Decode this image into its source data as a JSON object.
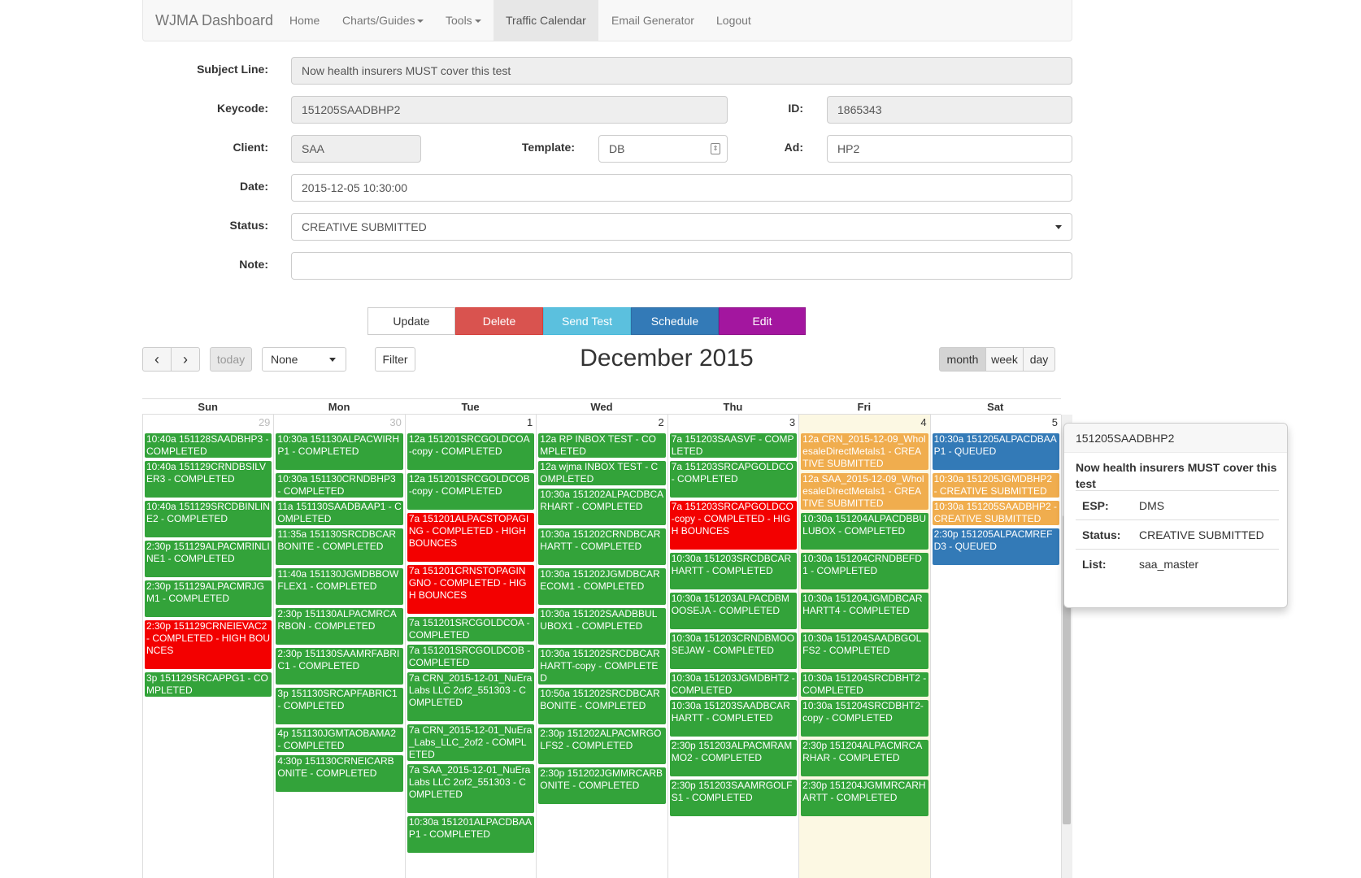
{
  "navbar": {
    "brand": "WJMA Dashboard",
    "items": [
      {
        "label": "Home"
      },
      {
        "label": "Charts/Guides"
      },
      {
        "label": "Tools"
      },
      {
        "label": "Traffic Calendar"
      },
      {
        "label": "Email Generator"
      },
      {
        "label": "Logout"
      }
    ]
  },
  "form": {
    "subject_label": "Subject Line:",
    "subject_value": "Now health insurers MUST cover this test",
    "keycode_label": "Keycode:",
    "keycode_value": "151205SAADBHP2",
    "id_label": "ID:",
    "id_value": "1865343",
    "client_label": "Client:",
    "client_value": "SAA",
    "template_label": "Template:",
    "template_value": "DB",
    "ad_label": "Ad:",
    "ad_value": "HP2",
    "date_label": "Date:",
    "date_value": "2015-12-05 10:30:00",
    "status_label": "Status:",
    "status_value": "CREATIVE SUBMITTED",
    "note_label": "Note:",
    "note_value": ""
  },
  "actions": {
    "update": "Update",
    "delete": "Delete",
    "send_test": "Send Test",
    "schedule": "Schedule",
    "edit": "Edit"
  },
  "toolbar": {
    "prev": "‹",
    "next": "›",
    "today": "today",
    "filter_select": "None",
    "filter": "Filter",
    "title": "December 2015",
    "month": "month",
    "week": "week",
    "day": "day"
  },
  "colors": {
    "completed": "#33a33a",
    "bounces": "#f30000",
    "creative_submitted": "#f0ad4e",
    "queued": "#337ab7",
    "today_bg": "#fcf8e3",
    "delete": "#d9534f",
    "send_test": "#5bc0de",
    "schedule": "#337ab7",
    "edit": "#a3169f"
  },
  "calendar": {
    "headers": [
      "Sun",
      "Mon",
      "Tue",
      "Wed",
      "Thu",
      "Fri",
      "Sat"
    ],
    "days": [
      {
        "num": "29",
        "other": true,
        "events": [
          {
            "text": "10:40a 151128SAADBHP3 - COMPLETED",
            "status": "completed",
            "lines": 2
          },
          {
            "text": "10:40a 151129CRNDBSILVER3 - COMPLETED",
            "status": "completed",
            "lines": 3
          },
          {
            "text": "10:40a 151129SRCDBINLINE2 - COMPLETED",
            "status": "completed",
            "lines": 3
          },
          {
            "text": "2:30p 151129ALPACMRINLINE1 - COMPLETED",
            "status": "completed",
            "lines": 3
          },
          {
            "text": "2:30p 151129ALPACMRJGM1 - COMPLETED",
            "status": "completed",
            "lines": 3
          },
          {
            "text": "2:30p 151129CRNEIEVAC2 - COMPLETED - HIGH BOUNCES",
            "status": "bounces",
            "lines": 4
          },
          {
            "text": "3p 151129SRCAPPG1 - COMPLETED",
            "status": "completed",
            "lines": 2
          }
        ]
      },
      {
        "num": "30",
        "other": true,
        "events": [
          {
            "text": "10:30a 151130ALPACWIRHP1 - COMPLETED",
            "status": "completed",
            "lines": 3
          },
          {
            "text": "10:30a 151130CRNDBHP3 - COMPLETED",
            "status": "completed",
            "lines": 2
          },
          {
            "text": "11a 151130SAADBAAP1 - COMPLETED",
            "status": "completed",
            "lines": 2
          },
          {
            "text": "11:35a 151130SRCDBCARBONITE - COMPLETED",
            "status": "completed",
            "lines": 3
          },
          {
            "text": "11:40a 151130JGMDBBOWFLEX1 - COMPLETED",
            "status": "completed",
            "lines": 3
          },
          {
            "text": "2:30p 151130ALPACMRCARBON - COMPLETED",
            "status": "completed",
            "lines": 3
          },
          {
            "text": "2:30p 151130SAAMRFABRIC1 - COMPLETED",
            "status": "completed",
            "lines": 3
          },
          {
            "text": "3p 151130SRCAPFABRIC1 - COMPLETED",
            "status": "completed",
            "lines": 3
          },
          {
            "text": "4p 151130JGMTAOBAMA2 - COMPLETED",
            "status": "completed",
            "lines": 2
          },
          {
            "text": "4:30p 151130CRNEICARBONITE - COMPLETED",
            "status": "completed",
            "lines": 3
          }
        ]
      },
      {
        "num": "1",
        "other": false,
        "events": [
          {
            "text": "12a 151201SRCGOLDCOA-copy - COMPLETED",
            "status": "completed",
            "lines": 3
          },
          {
            "text": "12a 151201SRCGOLDCOB-copy - COMPLETED",
            "status": "completed",
            "lines": 3
          },
          {
            "text": "7a 151201ALPACSTOPAGING - COMPLETED - HIGH BOUNCES",
            "status": "bounces",
            "lines": 4
          },
          {
            "text": "7a 151201CRNSTOPAGINGNO - COMPLETED - HIGH BOUNCES",
            "status": "bounces",
            "lines": 4
          },
          {
            "text": "7a 151201SRCGOLDCOA - COMPLETED",
            "status": "completed",
            "lines": 2
          },
          {
            "text": "7a 151201SRCGOLDCOB - COMPLETED",
            "status": "completed",
            "lines": 2
          },
          {
            "text": "7a CRN_2015-12-01_NuEra Labs LLC 2of2_551303 - COMPLETED",
            "status": "completed",
            "lines": 4
          },
          {
            "text": "7a CRN_2015-12-01_NuEra_Labs_LLC_2of2 - COMPLETED",
            "status": "completed",
            "lines": 3
          },
          {
            "text": "7a SAA_2015-12-01_NuEra Labs LLC 2of2_551303 - COMPLETED",
            "status": "completed",
            "lines": 4
          },
          {
            "text": "10:30a 151201ALPACDBAAP1 - COMPLETED",
            "status": "completed",
            "lines": 3
          }
        ]
      },
      {
        "num": "2",
        "other": false,
        "events": [
          {
            "text": "12a RP INBOX TEST - COMPLETED",
            "status": "completed",
            "lines": 2
          },
          {
            "text": "12a wjma INBOX TEST - COMPLETED",
            "status": "completed",
            "lines": 2
          },
          {
            "text": "10:30a 151202ALPACDBCARHART - COMPLETED",
            "status": "completed",
            "lines": 3
          },
          {
            "text": "10:30a 151202CRNDBCARHARTT - COMPLETED",
            "status": "completed",
            "lines": 3
          },
          {
            "text": "10:30a 151202JGMDBCARECOM1 - COMPLETED",
            "status": "completed",
            "lines": 3
          },
          {
            "text": "10:30a 151202SAADBBULUBOX1 - COMPLETED",
            "status": "completed",
            "lines": 3
          },
          {
            "text": "10:30a 151202SRCDBCARHARTT-copy - COMPLETED",
            "status": "completed",
            "lines": 3
          },
          {
            "text": "10:50a 151202SRCDBCARBONITE - COMPLETED",
            "status": "completed",
            "lines": 3
          },
          {
            "text": "2:30p 151202ALPACMRGOLFS2 - COMPLETED",
            "status": "completed",
            "lines": 3
          },
          {
            "text": "2:30p 151202JGMMRCARBONITE - COMPLETED",
            "status": "completed",
            "lines": 3
          }
        ]
      },
      {
        "num": "3",
        "other": false,
        "events": [
          {
            "text": "7a 151203SAASVF - COMPLETED",
            "status": "completed",
            "lines": 2
          },
          {
            "text": "7a 151203SRCAPGOLDCO - COMPLETED",
            "status": "completed",
            "lines": 3
          },
          {
            "text": "7a 151203SRCAPGOLDCO-copy - COMPLETED - HIGH BOUNCES",
            "status": "bounces",
            "lines": 4
          },
          {
            "text": "10:30a 151203SRCDBCARHARTT - COMPLETED",
            "status": "completed",
            "lines": 3
          },
          {
            "text": "10:30a 151203ALPACDBMOOSEJA - COMPLETED",
            "status": "completed",
            "lines": 3
          },
          {
            "text": "10:30a 151203CRNDBMOOSEJAW - COMPLETED",
            "status": "completed",
            "lines": 3
          },
          {
            "text": "10:30a 151203JGMDBHT2 - COMPLETED",
            "status": "completed",
            "lines": 2
          },
          {
            "text": "10:30a 151203SAADBCARHARTT - COMPLETED",
            "status": "completed",
            "lines": 3
          },
          {
            "text": "2:30p 151203ALPACMRAMMO2 - COMPLETED",
            "status": "completed",
            "lines": 3
          },
          {
            "text": "2:30p 151203SAAMRGOLFS1 - COMPLETED",
            "status": "completed",
            "lines": 3
          }
        ]
      },
      {
        "num": "4",
        "other": false,
        "today": true,
        "events": [
          {
            "text": "12a CRN_2015-12-09_WholesaleDirectMetals1 - CREATIVE SUBMITTED",
            "status": "creative_submitted",
            "lines": 3
          },
          {
            "text": "12a SAA_2015-12-09_WholesaleDirectMetals1 - CREATIVE SUBMITTED",
            "status": "creative_submitted",
            "lines": 3
          },
          {
            "text": "10:30a 151204ALPACDBBULUBOX - COMPLETED",
            "status": "completed",
            "lines": 3
          },
          {
            "text": "10:30a 151204CRNDBEFD1 - COMPLETED",
            "status": "completed",
            "lines": 3
          },
          {
            "text": "10:30a 151204JGMDBCARHARTT4 - COMPLETED",
            "status": "completed",
            "lines": 3
          },
          {
            "text": "10:30a 151204SAADBGOLFS2 - COMPLETED",
            "status": "completed",
            "lines": 3
          },
          {
            "text": "10:30a 151204SRCDBHT2 - COMPLETED",
            "status": "completed",
            "lines": 2
          },
          {
            "text": "10:30a 151204SRCDBHT2-copy - COMPLETED",
            "status": "completed",
            "lines": 3
          },
          {
            "text": "2:30p 151204ALPACMRCARHAR - COMPLETED",
            "status": "completed",
            "lines": 3
          },
          {
            "text": "2:30p 151204JGMMRCARHARTT - COMPLETED",
            "status": "completed",
            "lines": 3
          }
        ]
      },
      {
        "num": "5",
        "other": false,
        "events": [
          {
            "text": "10:30a 151205ALPACDBAAP1 - QUEUED",
            "status": "queued",
            "lines": 3
          },
          {
            "text": "10:30a 151205JGMDBHP2 - CREATIVE SUBMITTED",
            "status": "creative_submitted",
            "lines": 2
          },
          {
            "text": "10:30a 151205SAADBHP2 - CREATIVE SUBMITTED",
            "status": "creative_submitted",
            "lines": 2
          },
          {
            "text": "2:30p 151205ALPACMREFD3 - QUEUED",
            "status": "queued",
            "lines": 3
          }
        ]
      }
    ]
  },
  "popover": {
    "title": "151205SAADBHP2",
    "subject": "Now health insurers MUST cover this test",
    "rows": [
      {
        "key": "ESP:",
        "value": "DMS"
      },
      {
        "key": "Status:",
        "value": "CREATIVE SUBMITTED"
      },
      {
        "key": "List:",
        "value": "saa_master"
      }
    ]
  }
}
